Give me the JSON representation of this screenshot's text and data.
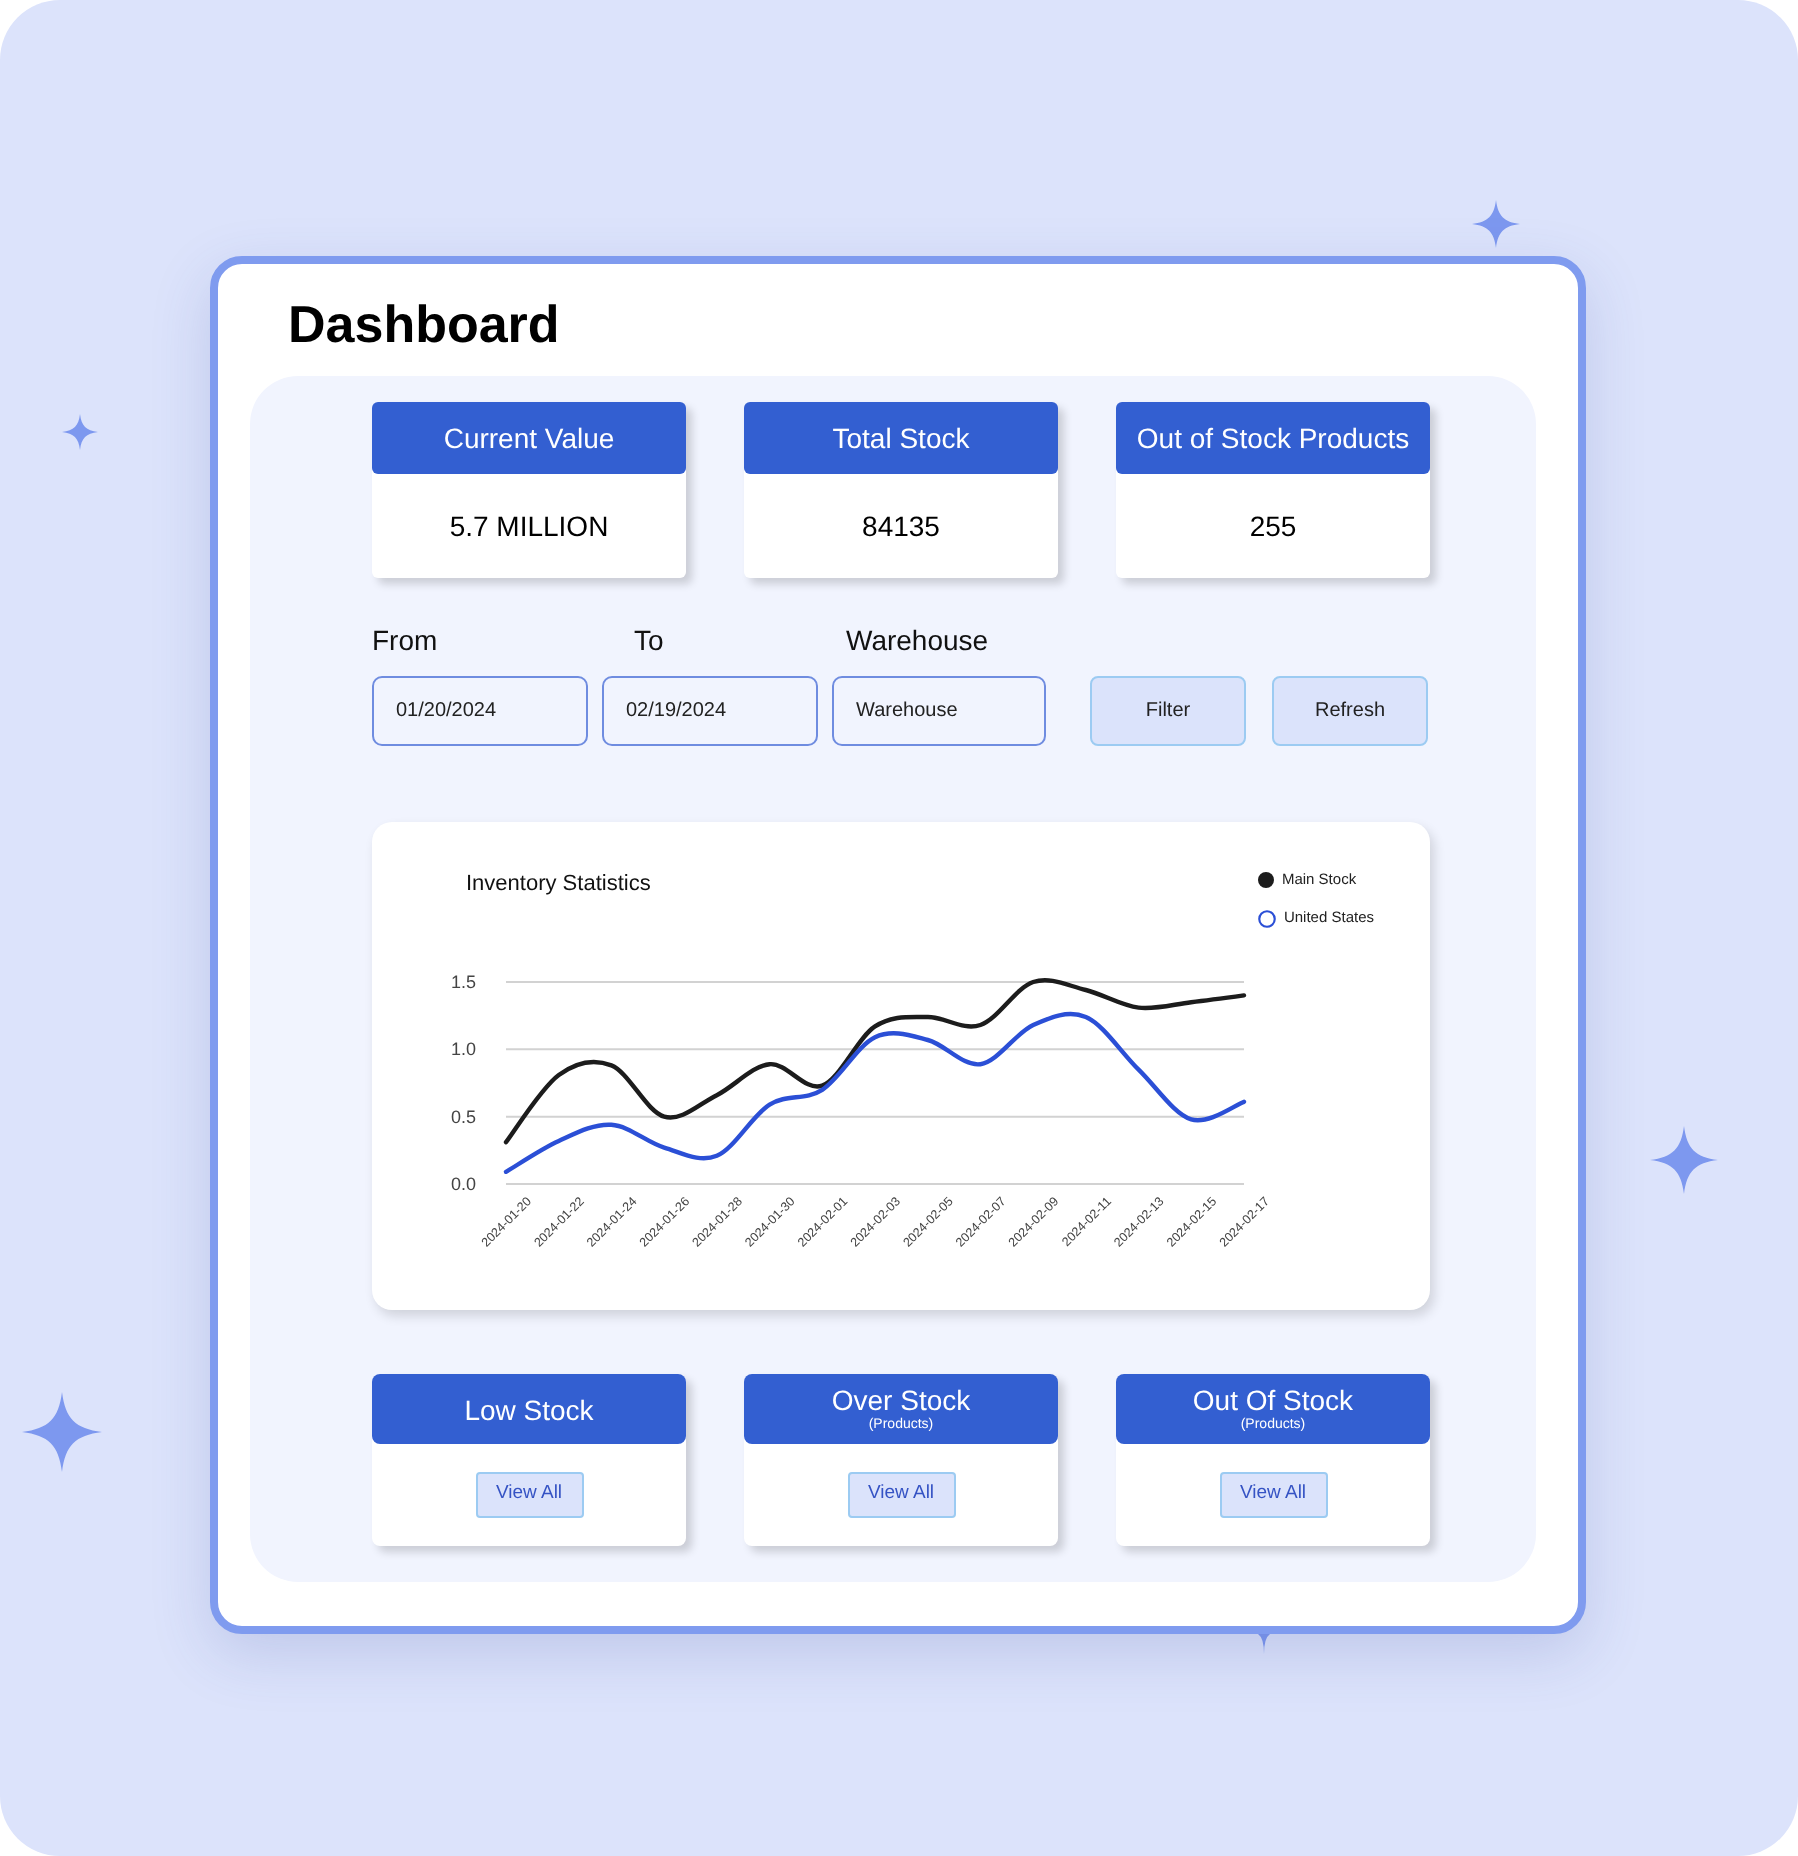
{
  "page_title": "Dashboard",
  "stats": [
    {
      "label": "Current Value",
      "value": "5.7 MILLION"
    },
    {
      "label": "Total Stock",
      "value": "84135"
    },
    {
      "label": "Out of Stock Products",
      "value": "255"
    }
  ],
  "filters": {
    "fields": [
      {
        "label": "From",
        "value": "01/20/2024"
      },
      {
        "label": "To",
        "value": "02/19/2024"
      },
      {
        "label": "Warehouse",
        "value": "Warehouse"
      }
    ],
    "buttons": [
      "Filter",
      "Refresh"
    ]
  },
  "chart": {
    "legend_items": [
      {
        "kind": "dot"
      },
      {
        "kind": "ring"
      }
    ],
    "chart_data": {
      "type": "line",
      "title": "Inventory Statistics",
      "categories": [
        "2024-01-20",
        "2024-01-22",
        "2024-01-24",
        "2024-01-26",
        "2024-01-28",
        "2024-01-30",
        "2024-02-01",
        "2024-02-03",
        "2024-02-05",
        "2024-02-07",
        "2024-02-09",
        "2024-02-11",
        "2024-02-13",
        "2024-02-15",
        "2024-02-17"
      ],
      "ylim": [
        0,
        1.5
      ],
      "yticks": [
        {
          "value": 0,
          "label": "0.0"
        },
        {
          "value": 0.5,
          "label": "0.5"
        },
        {
          "value": 1,
          "label": "1.0"
        },
        {
          "value": 1.5,
          "label": "1.5"
        }
      ],
      "grid": true,
      "legend": "upper right",
      "series": [
        {
          "name": "Main Stock",
          "color": "#1c1c1c",
          "values": [
            0.31,
            0.81,
            0.88,
            0.5,
            0.66,
            0.89,
            0.73,
            1.17,
            1.24,
            1.18,
            1.5,
            1.44,
            1.31,
            1.35,
            1.4
          ]
        },
        {
          "name": "United States",
          "color": "#2b4fd6",
          "values": [
            0.09,
            0.32,
            0.44,
            0.27,
            0.21,
            0.59,
            0.7,
            1.09,
            1.07,
            0.89,
            1.18,
            1.24,
            0.85,
            0.48,
            0.61
          ]
        }
      ]
    }
  },
  "stock_cards": [
    {
      "title": "Low Stock",
      "button": "View All"
    },
    {
      "title": "Over Stock",
      "subtitle": "(Products)",
      "button": "View All"
    },
    {
      "title": "Out Of Stock",
      "subtitle": "(Products)",
      "button": "View All"
    }
  ]
}
